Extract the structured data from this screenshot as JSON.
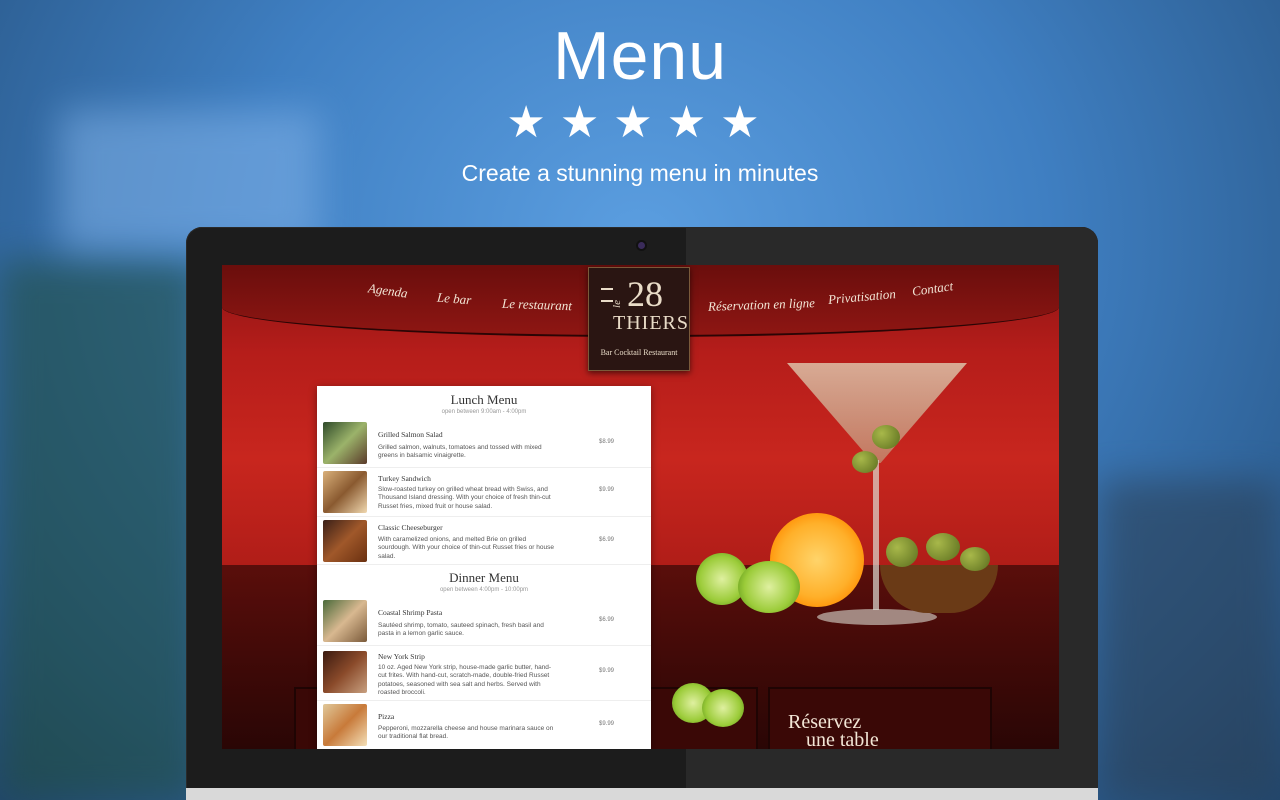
{
  "hero": {
    "title": "Menu",
    "stars": "★★★★★",
    "subtitle": "Create a stunning menu in minutes"
  },
  "site": {
    "nav": [
      "Agenda",
      "Le bar",
      "Le restaurant",
      "Réservation en ligne",
      "Privatisation",
      "Contact"
    ],
    "logo": {
      "number": "28",
      "le": "le",
      "name": "THIERS",
      "tagline": "Bar Cocktail Restaurant"
    },
    "reserve_line1": "Réservez",
    "reserve_line2": "une table"
  },
  "menu": {
    "lunch": {
      "title": "Lunch Menu",
      "hours": "open between 9:00am - 4:00pm",
      "items": [
        {
          "name": "Grilled Salmon Salad",
          "desc": "Grilled salmon, walnuts, tomatoes and tossed with mixed greens in balsamic vinaigrette.",
          "price": "$8.99"
        },
        {
          "name": "Turkey Sandwich",
          "desc": "Slow-roasted turkey on grilled wheat bread with Swiss, and Thousand Island dressing. With your choice of fresh thin-cut Russet fries, mixed fruit or house salad.",
          "price": "$9.99"
        },
        {
          "name": "Classic Cheeseburger",
          "desc": "With caramelized onions, and melted Brie on grilled sourdough. With your choice of thin-cut Russet fries or house salad.",
          "price": "$6.99"
        }
      ]
    },
    "dinner": {
      "title": "Dinner Menu",
      "hours": "open between 4:00pm - 10:00pm",
      "items": [
        {
          "name": "Coastal Shrimp Pasta",
          "desc": "Sautéed shrimp, tomato, sauteed spinach, fresh basil and pasta in a lemon garlic sauce.",
          "price": "$6.99"
        },
        {
          "name": "New York Strip",
          "desc": "10 oz. Aged New York strip, house-made garlic butter, hand-cut frites. With hand-cut, scratch-made, double-fried Russet potatoes, seasoned with sea salt and herbs. Served with roasted broccoli.",
          "price": "$9.99"
        },
        {
          "name": "Pizza",
          "desc": "Pepperoni, mozzarella cheese and house marinara sauce on our traditional flat bread.",
          "price": "$9.99"
        }
      ]
    }
  },
  "colors": {
    "accent": "#c8261e",
    "hero_bg": "#3f7fc2"
  }
}
